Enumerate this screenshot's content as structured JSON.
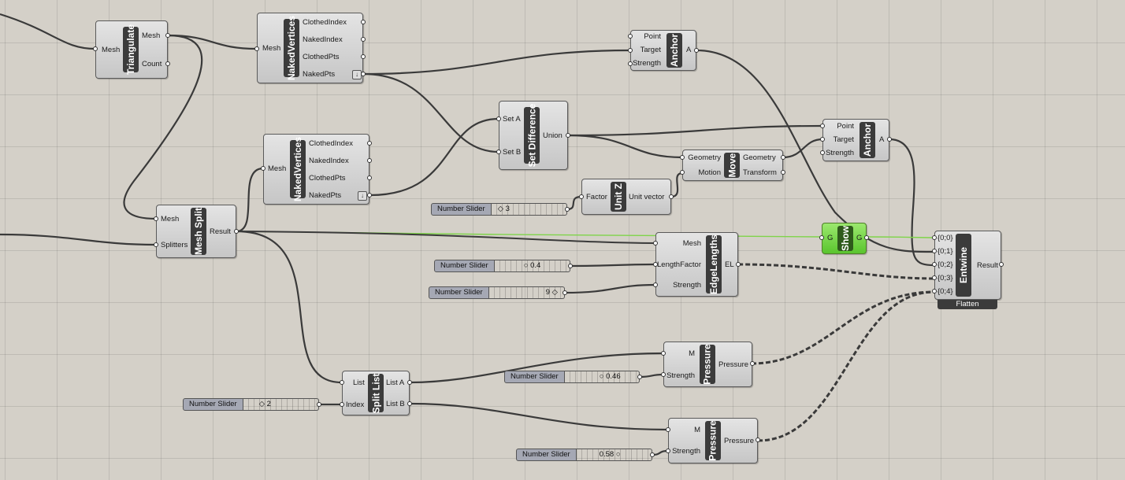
{
  "nodes": {
    "triangulate": {
      "title": "Triangulate",
      "in": [
        "Mesh"
      ],
      "out": [
        "Mesh",
        "Count"
      ]
    },
    "naked_vertices_1": {
      "title": "NakedVertices",
      "in": [
        "Mesh"
      ],
      "out": [
        "ClothedIndex",
        "NakedIndex",
        "ClothedPts",
        "NakedPts"
      ]
    },
    "naked_vertices_2": {
      "title": "NakedVertices",
      "in": [
        "Mesh"
      ],
      "out": [
        "ClothedIndex",
        "NakedIndex",
        "ClothedPts",
        "NakedPts"
      ]
    },
    "anchor_1": {
      "title": "Anchor",
      "in": [
        "Point",
        "Target",
        "Strength"
      ],
      "out": [
        "A"
      ]
    },
    "anchor_2": {
      "title": "Anchor",
      "in": [
        "Point",
        "Target",
        "Strength"
      ],
      "out": [
        "A"
      ]
    },
    "set_difference": {
      "title": "Set Difference",
      "in": [
        "Set A",
        "Set B"
      ],
      "out": [
        "Union"
      ]
    },
    "move": {
      "title": "Move",
      "in": [
        "Geometry",
        "Motion"
      ],
      "out": [
        "Geometry",
        "Transform"
      ]
    },
    "unit_z": {
      "title": "Unit Z",
      "in": [
        "Factor"
      ],
      "out": [
        "Unit vector"
      ]
    },
    "mesh_split": {
      "title": "Mesh Split",
      "in": [
        "Mesh",
        "Splitters"
      ],
      "out": [
        "Result"
      ]
    },
    "edge_lengths": {
      "title": "EdgeLengths",
      "in": [
        "Mesh",
        "LengthFactor",
        "Strength"
      ],
      "out": [
        "EL"
      ]
    },
    "show": {
      "title": "Show",
      "in": [
        "G"
      ],
      "out": [
        "G"
      ]
    },
    "entwine": {
      "title": "Entwine",
      "in": [
        "{0;0}",
        "{0;1}",
        "{0;2}",
        "{0;3}",
        "{0;4}"
      ],
      "out": [
        "Result"
      ],
      "footer": "Flatten"
    },
    "split_list": {
      "title": "Split List",
      "in": [
        "List",
        "Index"
      ],
      "out": [
        "List A",
        "List B"
      ]
    },
    "pressure_1": {
      "title": "Pressure",
      "in": [
        "M",
        "Strength"
      ],
      "out": [
        "Pressure"
      ]
    },
    "pressure_2": {
      "title": "Pressure",
      "in": [
        "M",
        "Strength"
      ],
      "out": [
        "Pressure"
      ]
    }
  },
  "sliders": {
    "s_factor": {
      "label": "Number Slider",
      "value": "3"
    },
    "s_lengthfactor": {
      "label": "Number Slider",
      "value": "0.4"
    },
    "s_strength_el": {
      "label": "Number Slider",
      "value": "9"
    },
    "s_index": {
      "label": "Number Slider",
      "value": "2"
    },
    "s_pressure_1": {
      "label": "Number Slider",
      "value": "0.46"
    },
    "s_pressure_2": {
      "label": "Number Slider",
      "value": "0.58"
    }
  },
  "colors": {
    "canvas": "#d4d0c8",
    "wire": "#3a3a3a",
    "wire_highlight": "#7fd44a",
    "node_bar": "#3b3b3b",
    "show_node": "#5ac52e"
  },
  "icons": {
    "download": "down-arrow-icon"
  }
}
